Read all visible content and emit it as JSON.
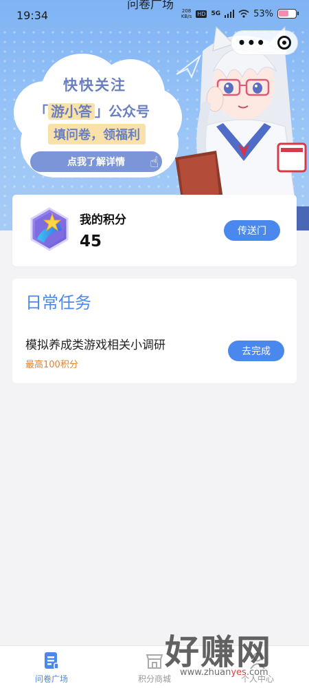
{
  "status_bar": {
    "time": "19:34",
    "page_title": "问卷广场",
    "net_speed_top": "208",
    "net_speed_bottom": "KB/s",
    "hd_label": "HD",
    "network": "5G",
    "battery": "53%"
  },
  "banner": {
    "title": "快快关注",
    "subtitle_bracket_open": "「",
    "subtitle_highlight": "游小答",
    "subtitle_bracket_close": "」",
    "subtitle_rest": "公众号",
    "line3": "填问卷，领福利",
    "cta_label": "点我了解详情"
  },
  "points": {
    "label": "我的积分",
    "value": "45",
    "portal_label": "传送门"
  },
  "daily_tasks": {
    "title": "日常任务",
    "items": [
      {
        "name": "模拟养成类游戏相关小调研",
        "reward": "最高100积分",
        "action": "去完成"
      }
    ]
  },
  "tabbar": {
    "items": [
      {
        "label": "问卷广场",
        "active": true
      },
      {
        "label": "积分商城",
        "active": false
      },
      {
        "label": "个人中心",
        "active": false
      }
    ]
  },
  "watermark": {
    "text": "好赚网",
    "url_pre": "www.zhuan",
    "url_mid": "yes",
    "url_post": ".com"
  },
  "colors": {
    "accent": "#4a88ee",
    "reward": "#e6812b",
    "banner_blue": "#9cc6f7"
  }
}
